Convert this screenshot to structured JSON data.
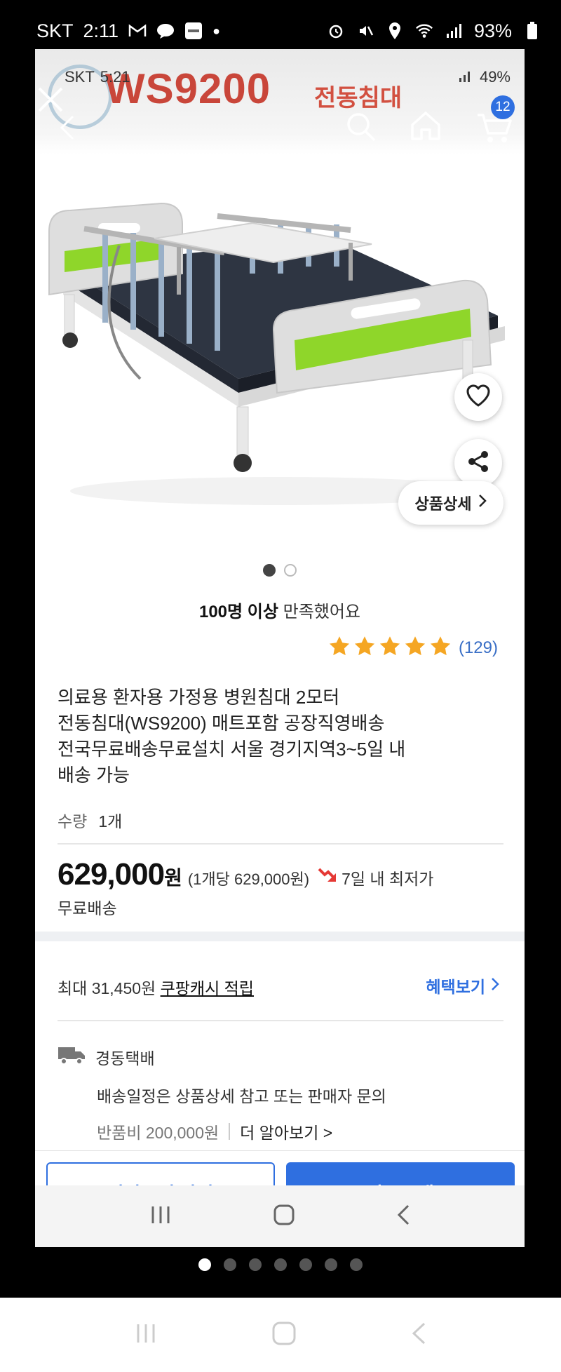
{
  "outer_status": {
    "carrier": "SKT",
    "time": "2:11",
    "battery": "93%",
    "left_icons": [
      "gmail-icon",
      "chat-icon",
      "ably-icon"
    ],
    "right_icons": [
      "alarm-icon",
      "mute-icon",
      "location-icon",
      "wifi-icon",
      "signal-icon",
      "battery-icon"
    ]
  },
  "inner_status": {
    "carrier": "SKT",
    "time": "5:21",
    "battery": "49%"
  },
  "banner": {
    "model": "WS9200",
    "subtitle": "전동침대"
  },
  "header": {
    "cart_count": "12"
  },
  "image": {
    "detail_button": "상품상세",
    "slides_total": 2,
    "slide_active": 1
  },
  "satisfaction": {
    "bold": "100명 이상",
    "text": "만족했어요"
  },
  "rating": {
    "stars": 5,
    "count": "(129)"
  },
  "product": {
    "title_lines": [
      "의료용 환자용 가정용 병원침대 2모터",
      "전동침대(WS9200) 매트포함 공장직영배송",
      "전국무료배송무료설치 서울 경기지역3~5일 내",
      "배송 가능"
    ],
    "qty_label": "수량",
    "qty_value": "1개",
    "price": "629,000",
    "price_unit": "원",
    "per_unit": "(1개당 629,000원)",
    "lowest_badge": "7일 내 최저가",
    "shipping": "무료배송"
  },
  "benefits": {
    "cash_prefix": "최대 31,450원",
    "cash_link": "쿠팡캐시 적립",
    "view_label": "혜택보기"
  },
  "delivery": {
    "courier": "경동택배",
    "schedule": "배송일정은 상품상세 참고 또는 판매자 문의",
    "return_fee": "반품비 200,000원",
    "learn_more": "더 알아보기 >"
  },
  "actions": {
    "add_to_cart": "장바구니 담기",
    "buy_now": "바로구매"
  },
  "gallery_pages": {
    "total": 7,
    "active": 1
  },
  "colors": {
    "accent": "#2f6fe0",
    "star": "#f5a623",
    "brand_red": "#c9463a"
  }
}
